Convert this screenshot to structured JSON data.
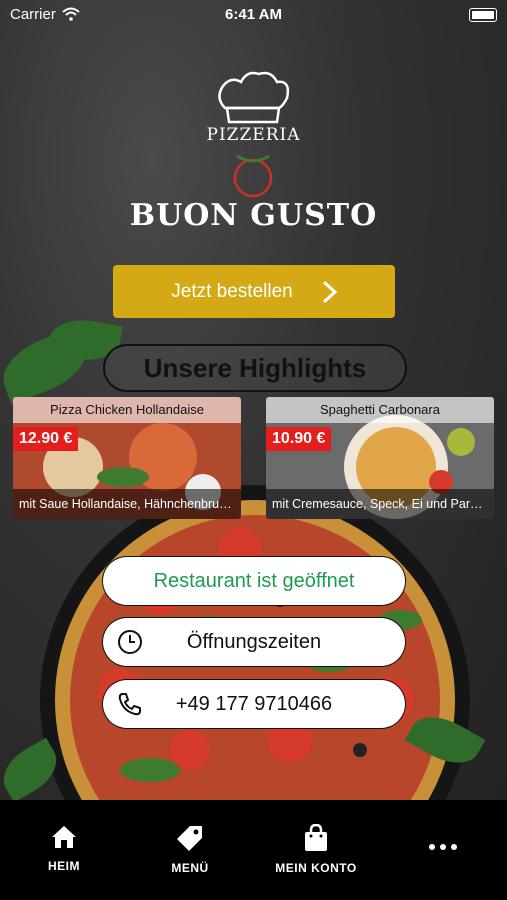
{
  "status_bar": {
    "carrier": "Carrier",
    "time": "6:41 AM"
  },
  "logo": {
    "subtitle": "PIZZERIA",
    "brand": "BUON GUSTO"
  },
  "order_button": {
    "label": "Jetzt bestellen"
  },
  "highlights": {
    "title": "Unsere Highlights",
    "items": [
      {
        "name": "Pizza Chicken Hollandaise",
        "price": "12.90 €",
        "description": "mit Saue Hollandaise, Hähnchenbrust, B..."
      },
      {
        "name": "Spaghetti Carbonara",
        "price": "10.90 €",
        "description": "mit Cremesauce, Speck, Ei und Parmesan"
      }
    ]
  },
  "info": {
    "status": "Restaurant ist geöffnet",
    "status_color": "#1f9a4f",
    "hours": "Öffnungszeiten",
    "phone": "+49 177 9710466"
  },
  "tabs": [
    {
      "label": "HEIM",
      "icon": "home-icon"
    },
    {
      "label": "MENÜ",
      "icon": "tag-icon"
    },
    {
      "label": "MEIN KONTO",
      "icon": "shopping-bag-icon"
    },
    {
      "label": "",
      "icon": "more-icon"
    }
  ],
  "colors": {
    "accent": "#d5a816",
    "price": "#e41d1d"
  }
}
